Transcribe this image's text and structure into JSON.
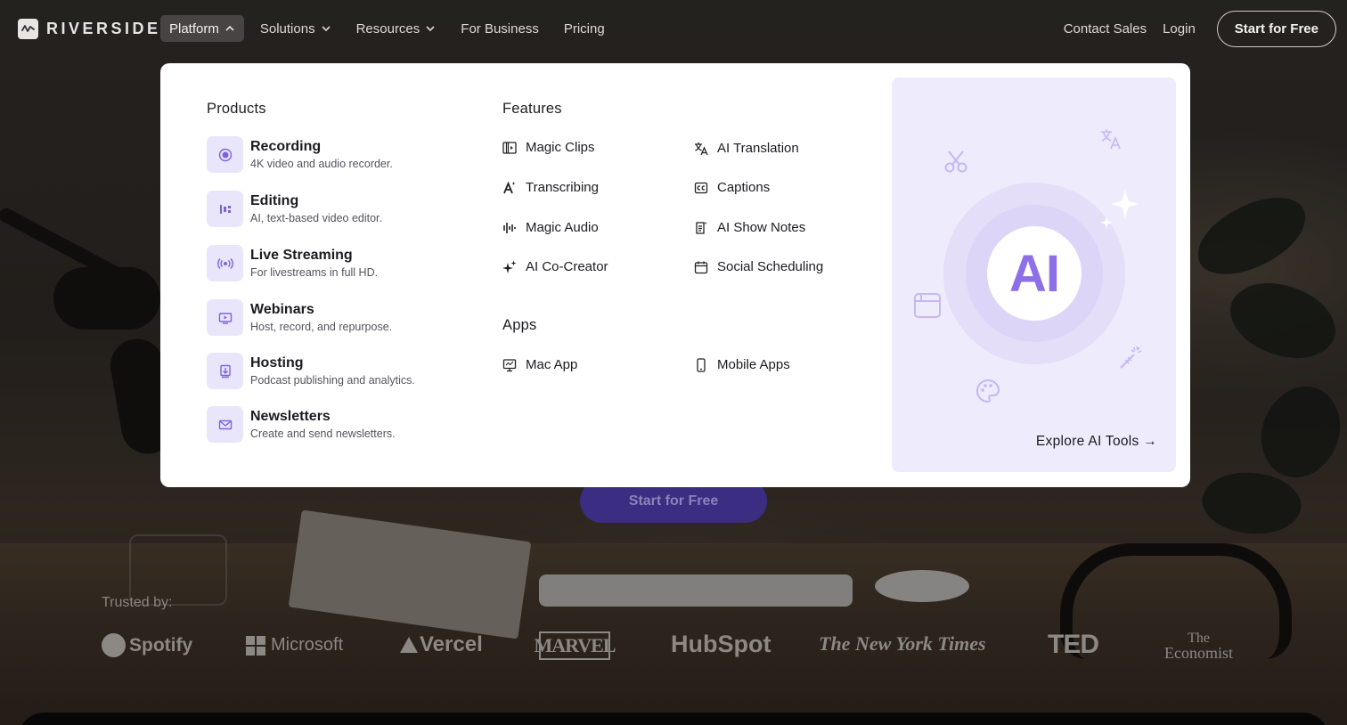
{
  "header": {
    "logo_text": "RIVERSIDE",
    "nav": [
      {
        "label": "Platform",
        "icon": "chevron-up-icon",
        "active": true
      },
      {
        "label": "Solutions",
        "icon": "chevron-down-icon"
      },
      {
        "label": "Resources",
        "icon": "chevron-down-icon"
      },
      {
        "label": "For Business"
      },
      {
        "label": "Pricing"
      }
    ],
    "contact_sales": "Contact Sales",
    "login": "Login",
    "cta": "Start for Free"
  },
  "menu": {
    "products_title": "Products",
    "products": [
      {
        "name": "Recording",
        "desc": "4K video and audio recorder.",
        "icon": "record-icon"
      },
      {
        "name": "Editing",
        "desc": "AI, text-based video editor.",
        "icon": "edit-timeline-icon"
      },
      {
        "name": "Live Streaming",
        "desc": "For livestreams in full HD.",
        "icon": "broadcast-icon"
      },
      {
        "name": "Webinars",
        "desc": "Host, record, and repurpose.",
        "icon": "webinar-screen-icon"
      },
      {
        "name": "Hosting",
        "desc": "Podcast publishing and analytics.",
        "icon": "upload-icon"
      },
      {
        "name": "Newsletters",
        "desc": "Create and send newsletters.",
        "icon": "mail-icon"
      }
    ],
    "features_title": "Features",
    "features": [
      {
        "label": "Magic Clips",
        "icon": "clips-icon"
      },
      {
        "label": "AI Translation",
        "icon": "translate-icon"
      },
      {
        "label": "Transcribing",
        "icon": "transcribe-icon"
      },
      {
        "label": "Captions",
        "icon": "captions-icon"
      },
      {
        "label": "Magic Audio",
        "icon": "audio-wave-icon"
      },
      {
        "label": "AI Show Notes",
        "icon": "notes-icon"
      },
      {
        "label": "AI Co-Creator",
        "icon": "sparkle-icon"
      },
      {
        "label": "Social Scheduling",
        "icon": "calendar-icon"
      }
    ],
    "apps_title": "Apps",
    "apps": [
      {
        "label": "Mac App",
        "icon": "monitor-icon"
      },
      {
        "label": "Mobile Apps",
        "icon": "phone-icon"
      }
    ],
    "ai_card": {
      "badge": "AI",
      "link": "Explore AI Tools →"
    }
  },
  "hero": {
    "cta": "Start for Free"
  },
  "trusted": {
    "label": "Trusted by:",
    "brands": [
      "Spotify",
      "Microsoft",
      "Vercel",
      "MARVEL",
      "HubSpot",
      "The New York Times",
      "TED",
      "The",
      "Economist"
    ]
  },
  "colors": {
    "accent": "#8d6fe8",
    "icon_bg": "#e9e6fb",
    "card_bg": "#eeebfc",
    "hero_cta": "#3b2d82"
  }
}
